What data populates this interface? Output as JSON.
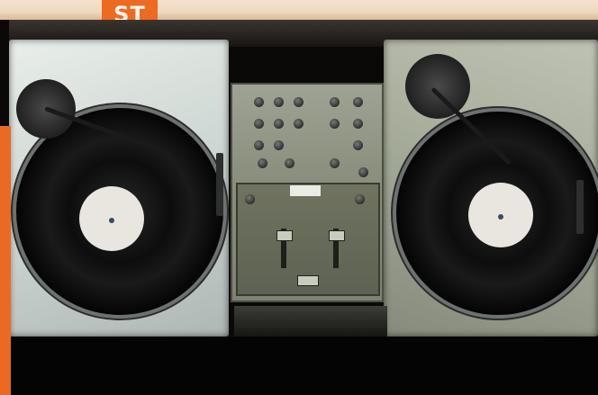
{
  "image": {
    "badge_text": "ST",
    "colors": {
      "badge": "#ec6a22",
      "banner": "#f2dcc4",
      "deck_left": "#dfe5e1",
      "deck_right": "#aeb3a1",
      "mixer": "#8e9382",
      "background": "#0b0908"
    }
  }
}
